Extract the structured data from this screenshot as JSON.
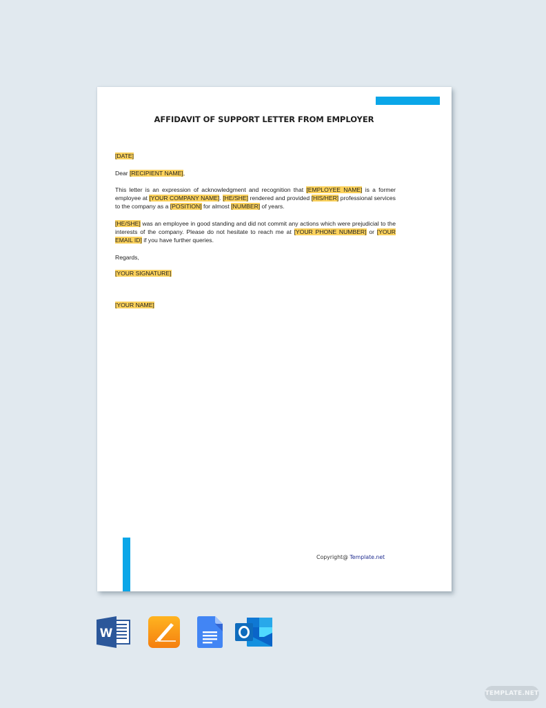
{
  "document": {
    "title": "AFFIDAVIT OF SUPPORT LETTER FROM EMPLOYER",
    "date_placeholder": "[DATE]",
    "salutation": {
      "prefix": "Dear ",
      "recipient": "[RECIPIENT NAME]",
      "suffix": ","
    },
    "paragraph1": {
      "t1": "This letter is an expression of acknowledgment and recognition that ",
      "employee_name": "[EMPLOYEE NAME]",
      "t2": " is a former employee at ",
      "company_name": "[YOUR COMPANY NAME]",
      "t3": ". ",
      "he_she": "[HE/SHE]",
      "t4": " rendered and provided ",
      "his_her": "[HIS/HER]",
      "t5": " professional services to the company as a ",
      "position": "[POSITION]",
      "t6": " for almost ",
      "number": "[NUMBER]",
      "t7": " of years."
    },
    "paragraph2": {
      "he_she": "[HE/SHE]",
      "t1": " was an employee in good standing and did not commit any actions which were prejudicial to the interests of the company. Please do not hesitate to reach me at ",
      "phone": "[YOUR PHONE NUMBER]",
      "t2": " or ",
      "email": "[YOUR EMAIL ID]",
      "t3": " if you have further queries."
    },
    "closing": "Regards,",
    "signature_placeholder": "[YOUR SIGNATURE]",
    "name_placeholder": "[YOUR NAME]",
    "footer": {
      "copyright_prefix": "Copyright@ ",
      "brand": "Template.net"
    }
  },
  "formats": [
    {
      "name": "Microsoft Word",
      "icon": "word-icon"
    },
    {
      "name": "Apple Pages",
      "icon": "pages-icon"
    },
    {
      "name": "Google Docs",
      "icon": "google-docs-icon"
    },
    {
      "name": "Microsoft Outlook",
      "icon": "outlook-icon"
    }
  ],
  "watermark": "TEMPLATE.NET",
  "colors": {
    "accent_blue": "#0aa6e8",
    "highlight": "#fcd25c",
    "background": "#e1e9ef"
  }
}
